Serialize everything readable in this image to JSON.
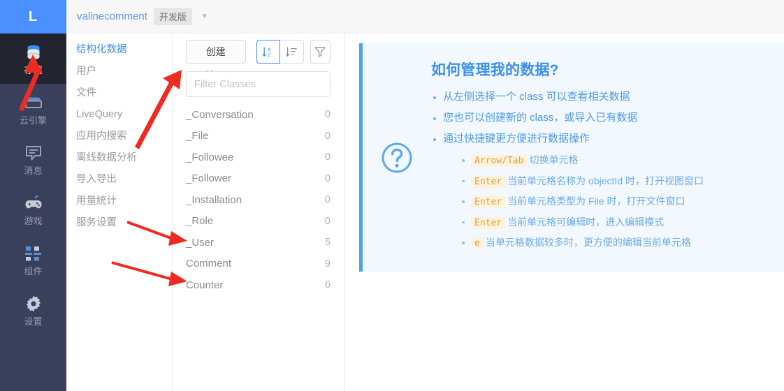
{
  "brand": {
    "logo_letter": "L",
    "logo_bg": "#4a90ff"
  },
  "rail": {
    "items": [
      {
        "label": "存储",
        "icon": "database-icon",
        "active": true
      },
      {
        "label": "云引擎",
        "icon": "cloud-engine-icon",
        "active": false
      },
      {
        "label": "消息",
        "icon": "message-icon",
        "active": false
      },
      {
        "label": "游戏",
        "icon": "gamepad-icon",
        "active": false
      },
      {
        "label": "组件",
        "icon": "components-icon",
        "active": false
      },
      {
        "label": "设置",
        "icon": "gear-icon",
        "active": false
      }
    ]
  },
  "topbar": {
    "app_name": "valinecomment",
    "env_badge": "开发版",
    "caret_icon": "chevron-down-icon"
  },
  "subnav": {
    "items": [
      {
        "label": "结构化数据",
        "active": true
      },
      {
        "label": "用户",
        "active": false
      },
      {
        "label": "文件",
        "active": false
      },
      {
        "label": "LiveQuery",
        "active": false
      },
      {
        "label": "应用内搜索",
        "active": false
      },
      {
        "label": "离线数据分析",
        "active": false
      },
      {
        "label": "导入导出",
        "active": false
      },
      {
        "label": "用量统计",
        "active": false
      },
      {
        "label": "服务设置",
        "active": false
      }
    ]
  },
  "classpanel": {
    "create_label": "创建 Class",
    "sort_alpha_icon": "sort-alphabetical-icon",
    "sort_list_icon": "sort-list-icon",
    "filter_icon": "funnel-filter-icon",
    "search_placeholder": "Filter Classes",
    "search_value": "",
    "classes": [
      {
        "name": "_Conversation",
        "count": "0"
      },
      {
        "name": "_File",
        "count": "0"
      },
      {
        "name": "_Followee",
        "count": "0"
      },
      {
        "name": "_Follower",
        "count": "0"
      },
      {
        "name": "_Installation",
        "count": "0"
      },
      {
        "name": "_Role",
        "count": "0"
      },
      {
        "name": "_User",
        "count": "5"
      },
      {
        "name": "Comment",
        "count": "9"
      },
      {
        "name": "Counter",
        "count": "6"
      }
    ]
  },
  "help": {
    "question_icon": "question-circle-icon",
    "title": "如何管理我的数据?",
    "bullets": [
      "从左侧选择一个 class 可以查看相关数据",
      "您也可以创建新的 class，或导入已有数据",
      "通过快捷键更方便进行数据操作"
    ],
    "shortcuts": [
      {
        "key": "Arrow/Tab",
        "text": "切换单元格"
      },
      {
        "key": "Enter",
        "text": "当前单元格名称为 objectId 时，打开视图窗口"
      },
      {
        "key": "Enter",
        "text": "当前单元格类型为 File 时，打开文件窗口"
      },
      {
        "key": "Enter",
        "text": "当前单元格可编辑时，进入编辑模式"
      },
      {
        "key": "e",
        "text": "当单元格数据较多时，更方便的编辑当前单元格"
      }
    ]
  },
  "annotations": {
    "arrow_color": "#ee2b22",
    "arrows": [
      {
        "name": "arrow-to-storage-nav"
      },
      {
        "name": "arrow-to-create-class"
      },
      {
        "name": "arrow-to-user-class"
      },
      {
        "name": "arrow-to-counter-class"
      }
    ]
  }
}
